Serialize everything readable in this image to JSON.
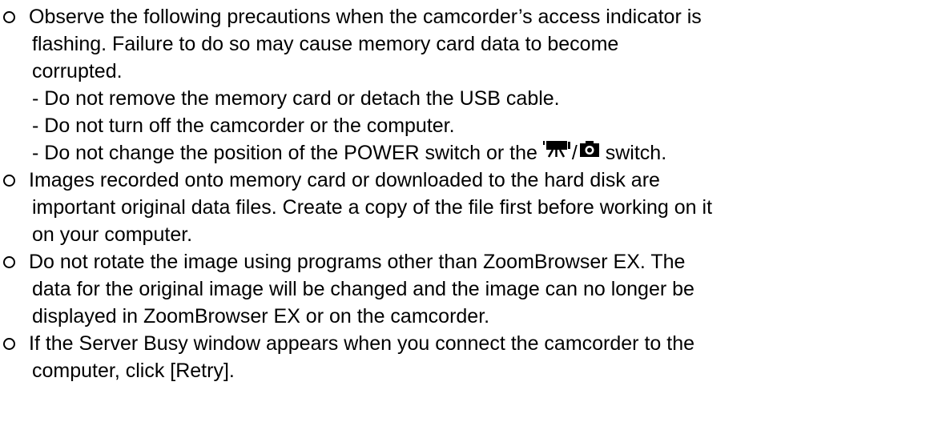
{
  "items": [
    {
      "lines": [
        "Observe the following precautions when the camcorder’s access indicator is",
        "flashing. Failure to do so may cause memory card data to become",
        "corrupted."
      ],
      "sub": [
        "- Do not remove the memory card or detach the USB cable.",
        "- Do not turn off the camcorder or the computer."
      ],
      "sub_last_before": "- Do not change the position of the POWER switch or the",
      "sub_last_after": "switch.",
      "mode_icons": [
        "movie-camera-icon",
        "still-camera-icon"
      ],
      "slash": "/"
    },
    {
      "lines": [
        "Images recorded onto memory card or downloaded to the hard disk are",
        "important original data files. Create a copy of the file first before working on it",
        "on your computer."
      ]
    },
    {
      "lines": [
        "Do not rotate the image using programs other than ZoomBrowser EX. The",
        "data for the original image will be changed and the image can no longer be",
        "displayed in ZoomBrowser EX or on the camcorder."
      ]
    },
    {
      "lines": [
        "If the Server Busy window appears when you connect the camcorder to the",
        "computer, click [Retry]."
      ]
    }
  ]
}
